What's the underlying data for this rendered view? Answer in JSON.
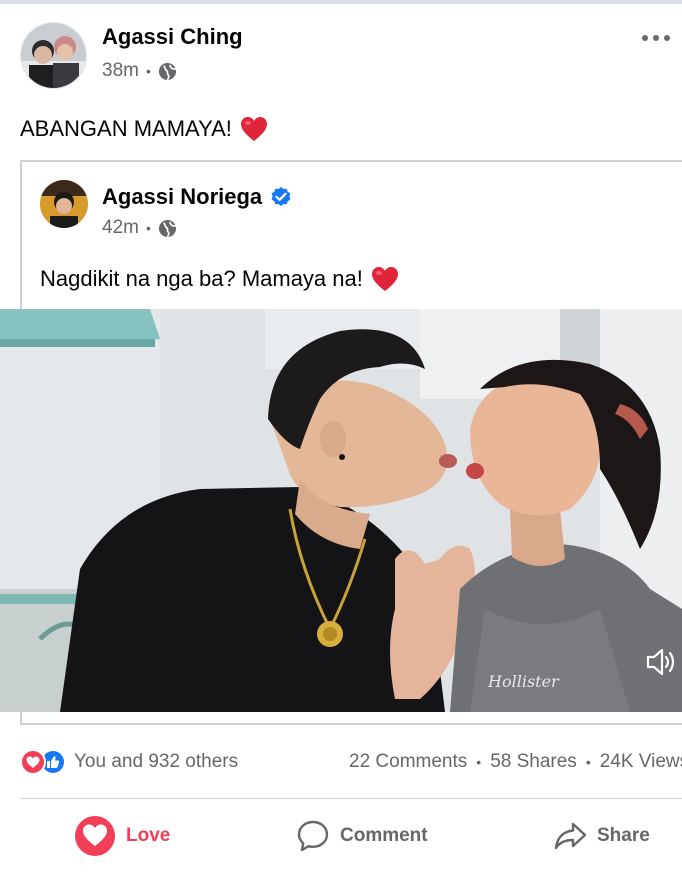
{
  "post": {
    "author": "Agassi Ching",
    "time": "38m",
    "privacy_icon": "globe-icon",
    "text": "ABANGAN MAMAYA!",
    "emoji": "red-heart"
  },
  "shared_post": {
    "author": "Agassi Noriega",
    "verified": true,
    "time": "42m",
    "privacy_icon": "globe-icon",
    "text": "Nagdikit na nga ba? Mamaya na!",
    "emoji": "red-heart",
    "video": {
      "shirt_text": "Hollister",
      "muted_icon": "volume-icon"
    }
  },
  "stats": {
    "reactions_text": "You and 932 others",
    "comments": "22 Comments",
    "shares": "58 Shares",
    "views": "24K Views",
    "separator": "•"
  },
  "actions": {
    "love": "Love",
    "comment": "Comment",
    "share": "Share"
  },
  "colors": {
    "love": "#f33e58",
    "like": "#1877f2",
    "verified": "#1877f2",
    "secondary_text": "#65676b"
  }
}
